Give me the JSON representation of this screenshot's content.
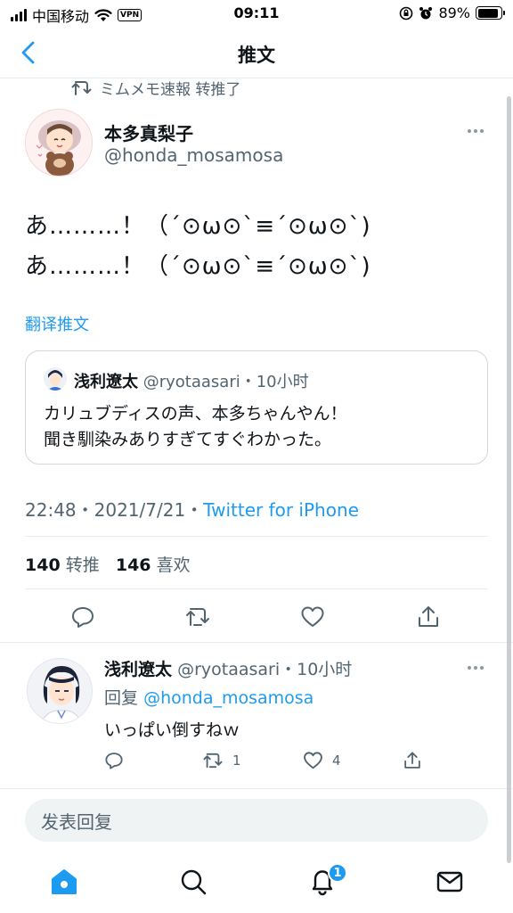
{
  "status_bar": {
    "carrier": "中国移动",
    "vpn": "VPN",
    "time": "09:11",
    "battery_text": "89%",
    "battery_level": 0.89
  },
  "nav": {
    "title": "推文"
  },
  "retweet_context": {
    "text": "ミムメモ速報 转推了"
  },
  "tweet": {
    "name": "本多真梨子",
    "handle": "@honda_mosamosa",
    "line1": "あ………！（´⊙ω⊙`≡´⊙ω⊙`)",
    "line2": "あ………！（´⊙ω⊙`≡´⊙ω⊙`)",
    "translate": "翻译推文",
    "quote": {
      "name": "浅利遼太",
      "handle_time": "@ryotaasari・10小时",
      "line1": "カリュブディスの声、本多ちゃんやん！",
      "line2": "聞き馴染みありすぎてすぐわかった。"
    },
    "time": "22:48・2021/7/21・",
    "source": "Twitter for iPhone",
    "retweets": "140",
    "retweets_label": "转推",
    "likes": "146",
    "likes_label": "喜欢"
  },
  "reply": {
    "name": "浅利遼太",
    "handle_time": "@ryotaasari・10小时",
    "reply_prefix": "回复",
    "reply_to": "@honda_mosamosa",
    "text": "いっぱい倒すねｗ",
    "retweet_count": "1",
    "like_count": "4"
  },
  "compose": {
    "placeholder": "发表回复"
  },
  "tabbar": {
    "notification_badge": "1"
  },
  "colors": {
    "accent": "#1d9bf0",
    "text": "#0f1419",
    "muted": "#536471"
  },
  "icons": [
    "back-chevron-icon",
    "retweet-icon",
    "more-icon",
    "reply-icon",
    "like-icon",
    "share-icon",
    "home-icon",
    "search-icon",
    "bell-icon",
    "mail-icon"
  ]
}
